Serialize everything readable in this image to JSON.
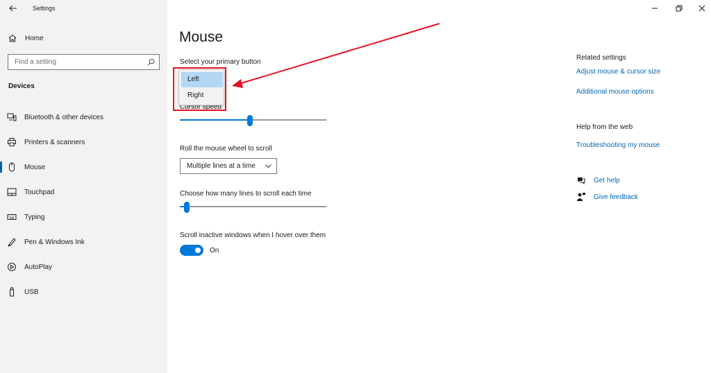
{
  "window": {
    "app_title": "Settings"
  },
  "sidebar": {
    "home_label": "Home",
    "search_placeholder": "Find a setting",
    "section_title": "Devices",
    "items": [
      {
        "label": "Bluetooth & other devices",
        "icon": "bluetooth-devices-icon"
      },
      {
        "label": "Printers & scanners",
        "icon": "printer-icon"
      },
      {
        "label": "Mouse",
        "icon": "mouse-icon",
        "active": true
      },
      {
        "label": "Touchpad",
        "icon": "touchpad-icon"
      },
      {
        "label": "Typing",
        "icon": "keyboard-icon"
      },
      {
        "label": "Pen & Windows Ink",
        "icon": "pen-icon"
      },
      {
        "label": "AutoPlay",
        "icon": "autoplay-icon"
      },
      {
        "label": "USB",
        "icon": "usb-icon"
      }
    ]
  },
  "main": {
    "page_title": "Mouse",
    "primary_button": {
      "label": "Select your primary button",
      "options": [
        "Left",
        "Right"
      ],
      "selected": "Left"
    },
    "cursor_speed": {
      "label": "Cursor speed",
      "value_fraction": 0.48
    },
    "scroll_wheel": {
      "label": "Roll the mouse wheel to scroll",
      "value": "Multiple lines at a time"
    },
    "scroll_lines": {
      "label": "Choose how many lines to scroll each time",
      "value_fraction": 0.03
    },
    "inactive_scroll": {
      "label": "Scroll inactive windows when I hover over them",
      "state": "On"
    }
  },
  "related": {
    "heading": "Related settings",
    "links": [
      "Adjust mouse & cursor size",
      "Additional mouse options"
    ],
    "help_heading": "Help from the web",
    "help_link": "Troubleshooting my mouse",
    "get_help": "Get help",
    "give_feedback": "Give feedback"
  },
  "colors": {
    "accent": "#0078d7",
    "link": "#0067b8",
    "annotation": "#e81123",
    "sidebar_bg": "#f2f2f2"
  }
}
